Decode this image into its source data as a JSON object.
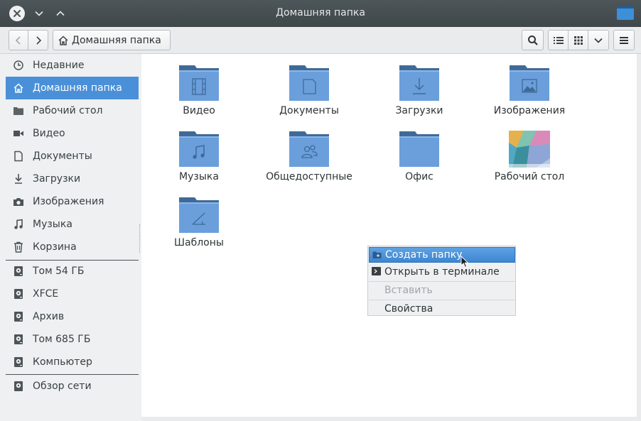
{
  "window": {
    "title": "Домашняя папка"
  },
  "toolbar": {
    "path_label": "Домашняя папка"
  },
  "sidebar": {
    "places": [
      {
        "label": "Недавние",
        "icon": "clock-icon"
      },
      {
        "label": "Домашняя папка",
        "icon": "home-icon",
        "active": true
      },
      {
        "label": "Рабочий стол",
        "icon": "folder-icon"
      },
      {
        "label": "Видео",
        "icon": "video-icon"
      },
      {
        "label": "Документы",
        "icon": "document-icon"
      },
      {
        "label": "Загрузки",
        "icon": "download-icon"
      },
      {
        "label": "Изображения",
        "icon": "camera-icon"
      },
      {
        "label": "Музыка",
        "icon": "music-icon"
      },
      {
        "label": "Корзина",
        "icon": "trash-icon"
      }
    ],
    "devices": [
      {
        "label": "Том 54 ГБ",
        "icon": "drive-icon"
      },
      {
        "label": "XFCE",
        "icon": "drive-icon"
      },
      {
        "label": "Архив",
        "icon": "drive-icon"
      },
      {
        "label": "Том 685 ГБ",
        "icon": "drive-icon"
      },
      {
        "label": "Компьютер",
        "icon": "drive-icon"
      }
    ],
    "network": [
      {
        "label": "Обзор сети",
        "icon": "network-icon"
      }
    ]
  },
  "files": [
    {
      "label": "Видео",
      "emblem": "film-emblem"
    },
    {
      "label": "Документы",
      "emblem": "document-emblem"
    },
    {
      "label": "Загрузки",
      "emblem": "download-emblem"
    },
    {
      "label": "Изображения",
      "emblem": "picture-emblem"
    },
    {
      "label": "Музыка",
      "emblem": "music-emblem"
    },
    {
      "label": "Общедоступные",
      "emblem": "people-emblem"
    },
    {
      "label": "Офис",
      "emblem": "none"
    },
    {
      "label": "Рабочий стол",
      "emblem": "wallpaper-thumbnail"
    },
    {
      "label": "Шаблоны",
      "emblem": "ruler-emblem"
    }
  ],
  "context_menu": {
    "items": [
      {
        "label": "Создать папку",
        "state": "highlighted",
        "icon": "new-folder-icon"
      },
      {
        "label": "Открыть в терминале",
        "state": "normal",
        "icon": "terminal-icon"
      },
      {
        "label": "Вставить",
        "state": "disabled"
      },
      {
        "label": "Свойства",
        "state": "normal"
      }
    ]
  },
  "colors": {
    "accent": "#4a90d9",
    "folder": "#6a9fdc",
    "folder_tab": "#3f6a98",
    "titlebar": "#464e51"
  }
}
